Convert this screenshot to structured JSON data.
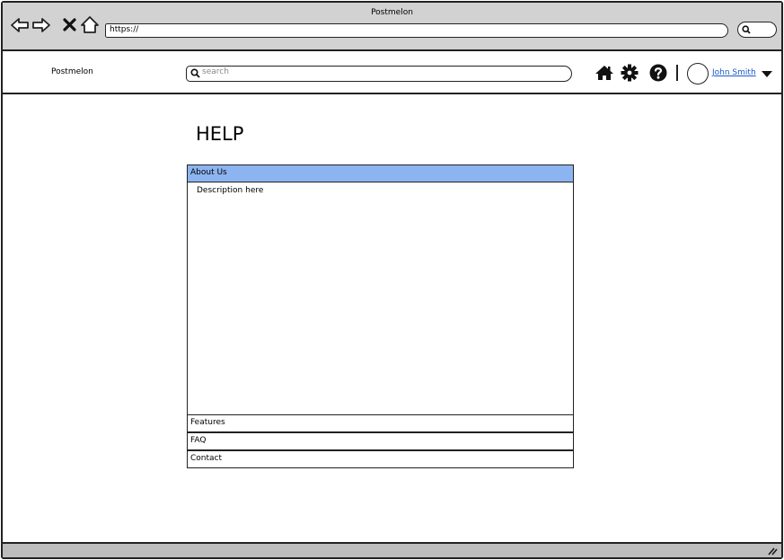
{
  "window": {
    "title": "Postmelon"
  },
  "browser": {
    "url": "https://",
    "back_icon": "arrow-left-icon",
    "forward_icon": "arrow-right-icon",
    "stop_icon": "close-icon",
    "home_icon": "home-outline-icon",
    "search_icon": "search-icon"
  },
  "header": {
    "brand": "Postmelon",
    "search_placeholder": "search",
    "icons": [
      "home-icon",
      "gear-icon",
      "help-icon"
    ],
    "user_name": "John Smith"
  },
  "main": {
    "title": "HELP",
    "sections": [
      {
        "label": "About Us",
        "expanded": true,
        "description": "Description here"
      },
      {
        "label": "Features",
        "expanded": false
      },
      {
        "label": "FAQ",
        "expanded": false
      },
      {
        "label": "Contact",
        "expanded": false
      }
    ]
  },
  "colors": {
    "active_section": "#8cb4f0",
    "link": "#1a5ac8",
    "chrome": "#d2d2d2"
  }
}
